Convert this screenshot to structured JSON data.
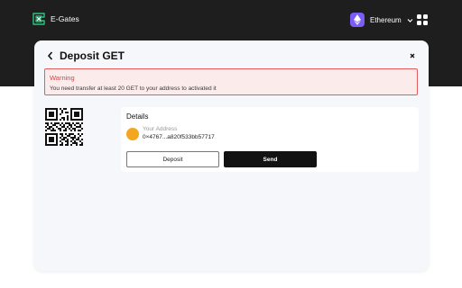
{
  "colors": {
    "header_bg": "#1e1e1e",
    "network_badge": "#7b5cf4",
    "warning_border": "#e45b5b",
    "warning_bg": "#fcebeb",
    "warning_title": "#d94141",
    "avatar": "#f4a620",
    "send_bg": "#121212"
  },
  "header": {
    "brand_name": "E-Gates",
    "brand_icon": "e-gates-logo-icon",
    "network": {
      "name": "Ethereum",
      "icon": "ethereum-icon",
      "dropdown_icon": "chevron-down-icon"
    },
    "apps_icon": "grid-apps-icon"
  },
  "modal": {
    "title": "Deposit GET",
    "back_icon": "chevron-left-icon",
    "close_icon": "close-icon",
    "warning": {
      "title": "Warning",
      "message": "You need transfer at least 20 GET to your address to activated it"
    },
    "qr_icon": "qr-code",
    "details": {
      "title": "Details",
      "address_label": "Your Address",
      "address_value": "0×4767...a820f533bb57717"
    },
    "buttons": {
      "deposit": "Deposit",
      "send": "Send"
    }
  }
}
